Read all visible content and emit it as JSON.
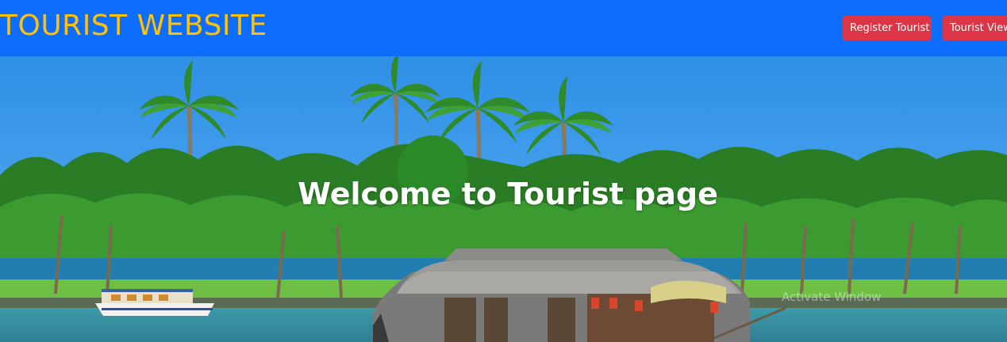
{
  "navbar": {
    "brand": "TOURIST WEBSITE",
    "buttons": [
      {
        "label": "Register Tourist"
      },
      {
        "label": "Tourist View"
      }
    ],
    "colors": {
      "bar": "#0d6efd",
      "brand": "#ffc107",
      "button": "#dc3545"
    }
  },
  "hero": {
    "title": "Welcome to Tourist page",
    "image": "backwater-houseboat-palm-trees",
    "watermark": "Activate Window"
  }
}
